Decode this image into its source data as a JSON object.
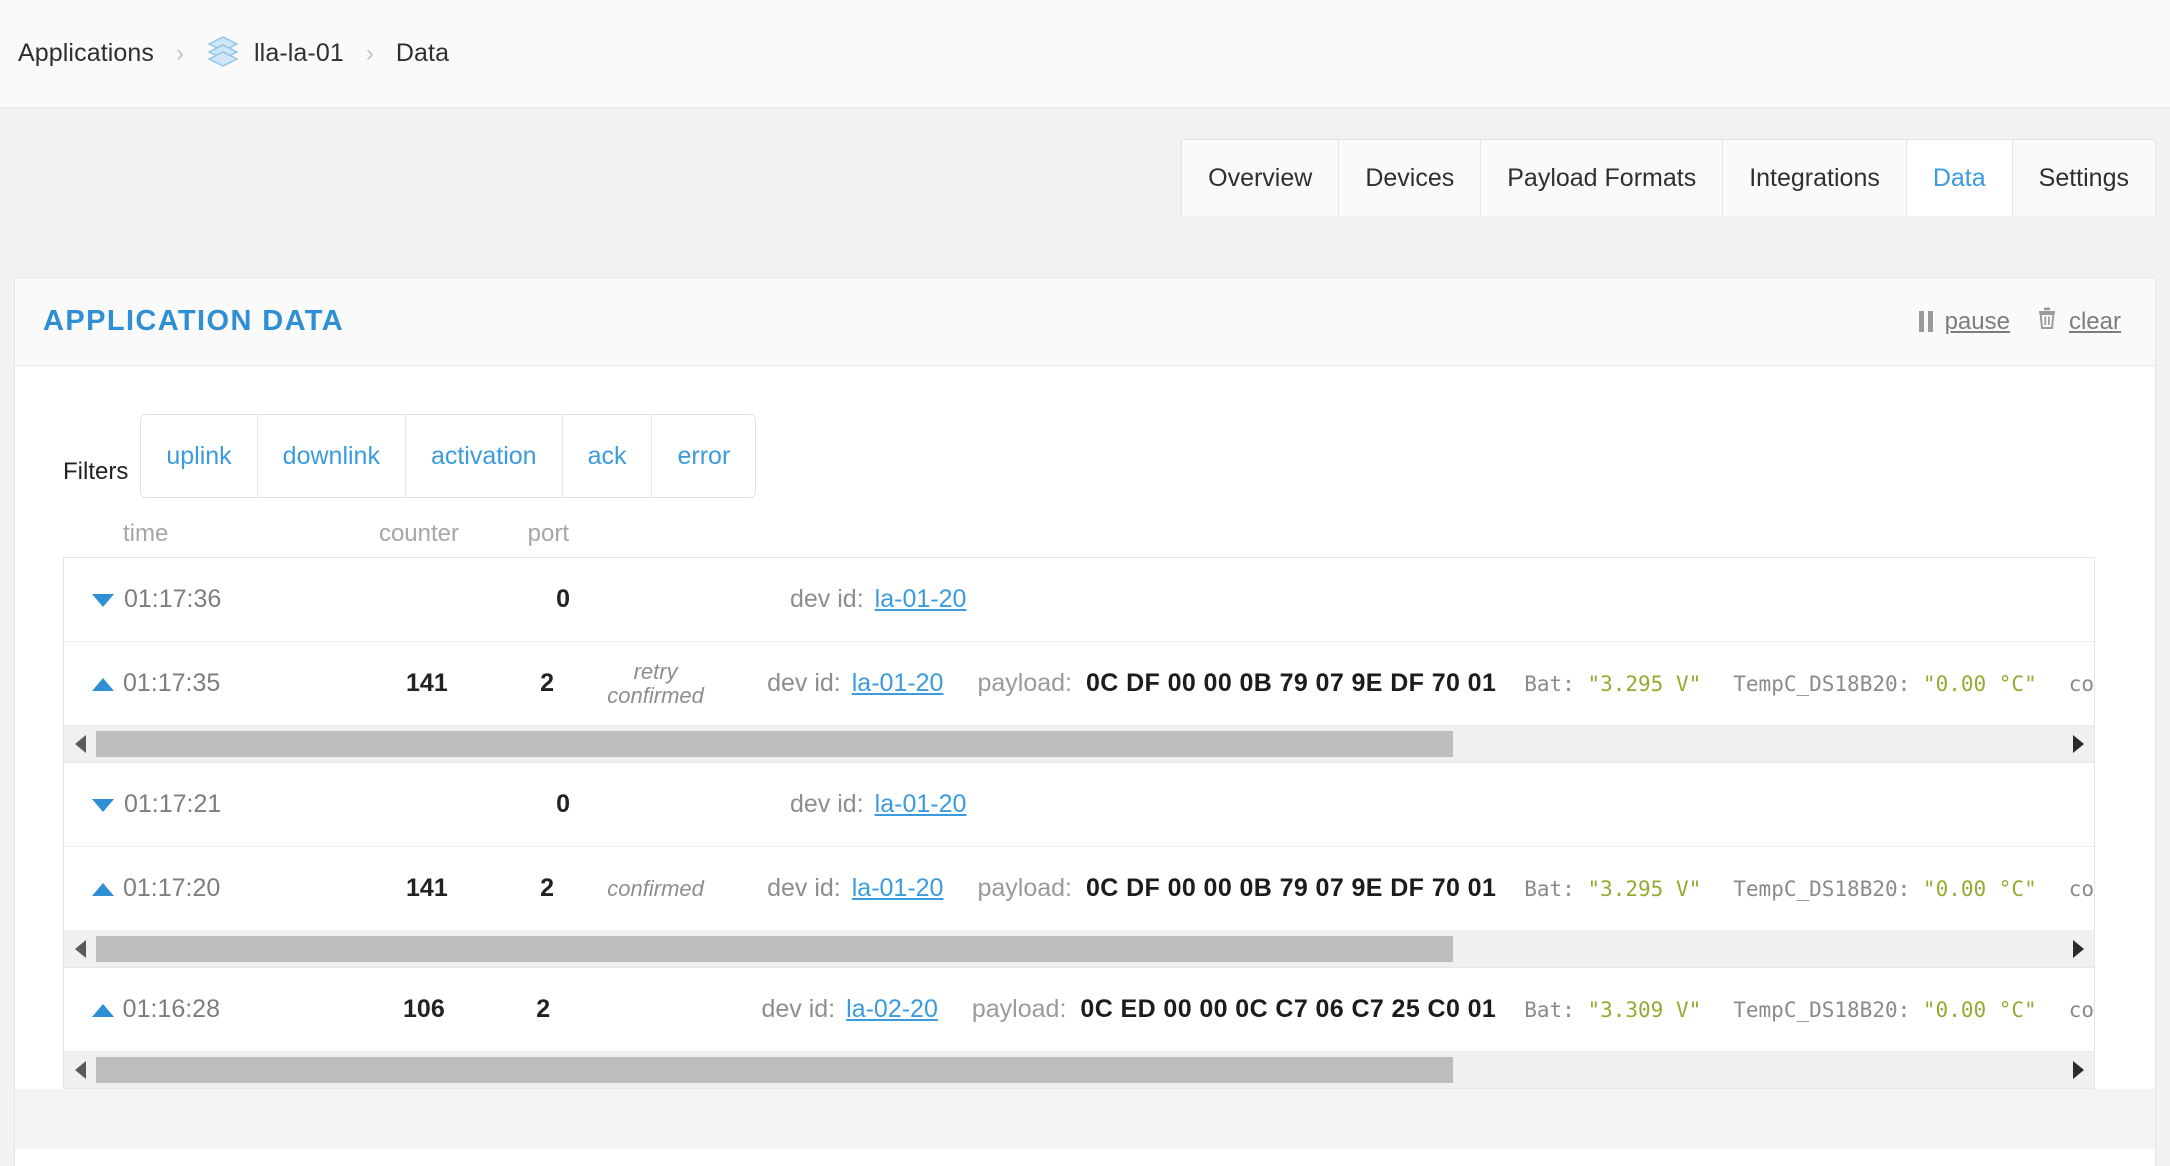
{
  "breadcrumb": {
    "root": "Applications",
    "separator": "›",
    "app": "lla-la-01",
    "current": "Data",
    "app_icon": "stack-icon"
  },
  "tabs": [
    {
      "label": "Overview",
      "active": false
    },
    {
      "label": "Devices",
      "active": false
    },
    {
      "label": "Payload Formats",
      "active": false
    },
    {
      "label": "Integrations",
      "active": false
    },
    {
      "label": "Data",
      "active": true
    },
    {
      "label": "Settings",
      "active": false
    }
  ],
  "panel": {
    "title": "APPLICATION DATA",
    "actions": {
      "pause_label": "pause",
      "pause_icon": "pause-icon",
      "clear_label": "clear",
      "clear_icon": "trash-icon"
    }
  },
  "filters": {
    "label": "Filters",
    "options": [
      "uplink",
      "downlink",
      "activation",
      "ack",
      "error"
    ]
  },
  "table": {
    "headers": {
      "time": "time",
      "counter": "counter",
      "port": "port"
    },
    "devid_label": "dev id:",
    "payload_label": "payload:",
    "rows": [
      {
        "direction": "down",
        "time": "01:17:36",
        "counter": "",
        "port": "0",
        "status": "",
        "devid": "la-01-20",
        "payload": "",
        "fields": [],
        "truncated": "",
        "scrollbar": false
      },
      {
        "direction": "up",
        "time": "01:17:35",
        "counter": "141",
        "port": "2",
        "status": "retry\nconfirmed",
        "devid": "la-01-20",
        "payload": "0C DF 00 00 0B 79 07 9E DF 70 01",
        "fields": [
          {
            "key": "Bat:",
            "value": "\"3.295 V\""
          },
          {
            "key": "TempC_DS18B20:",
            "value": "\"0.00 °C\""
          }
        ],
        "truncated": "co",
        "scrollbar": true
      },
      {
        "direction": "down",
        "time": "01:17:21",
        "counter": "",
        "port": "0",
        "status": "",
        "devid": "la-01-20",
        "payload": "",
        "fields": [],
        "truncated": "",
        "scrollbar": false
      },
      {
        "direction": "up",
        "time": "01:17:20",
        "counter": "141",
        "port": "2",
        "status": "confirmed",
        "devid": "la-01-20",
        "payload": "0C DF 00 00 0B 79 07 9E DF 70 01",
        "fields": [
          {
            "key": "Bat:",
            "value": "\"3.295 V\""
          },
          {
            "key": "TempC_DS18B20:",
            "value": "\"0.00 °C\""
          }
        ],
        "truncated": "co",
        "scrollbar": true
      },
      {
        "direction": "up",
        "time": "01:16:28",
        "counter": "106",
        "port": "2",
        "status": "",
        "devid": "la-02-20",
        "payload": "0C ED 00 00 0C C7 06 C7 25 C0 01",
        "fields": [
          {
            "key": "Bat:",
            "value": "\"3.309 V\""
          },
          {
            "key": "TempC_DS18B20:",
            "value": "\"0.00 °C\""
          }
        ],
        "truncated": "co",
        "scrollbar": true
      }
    ]
  },
  "colors": {
    "accent": "#3b9bdd",
    "title": "#2e8fd4",
    "value": "#9aa832",
    "page_bg": "#f2f2f2"
  }
}
